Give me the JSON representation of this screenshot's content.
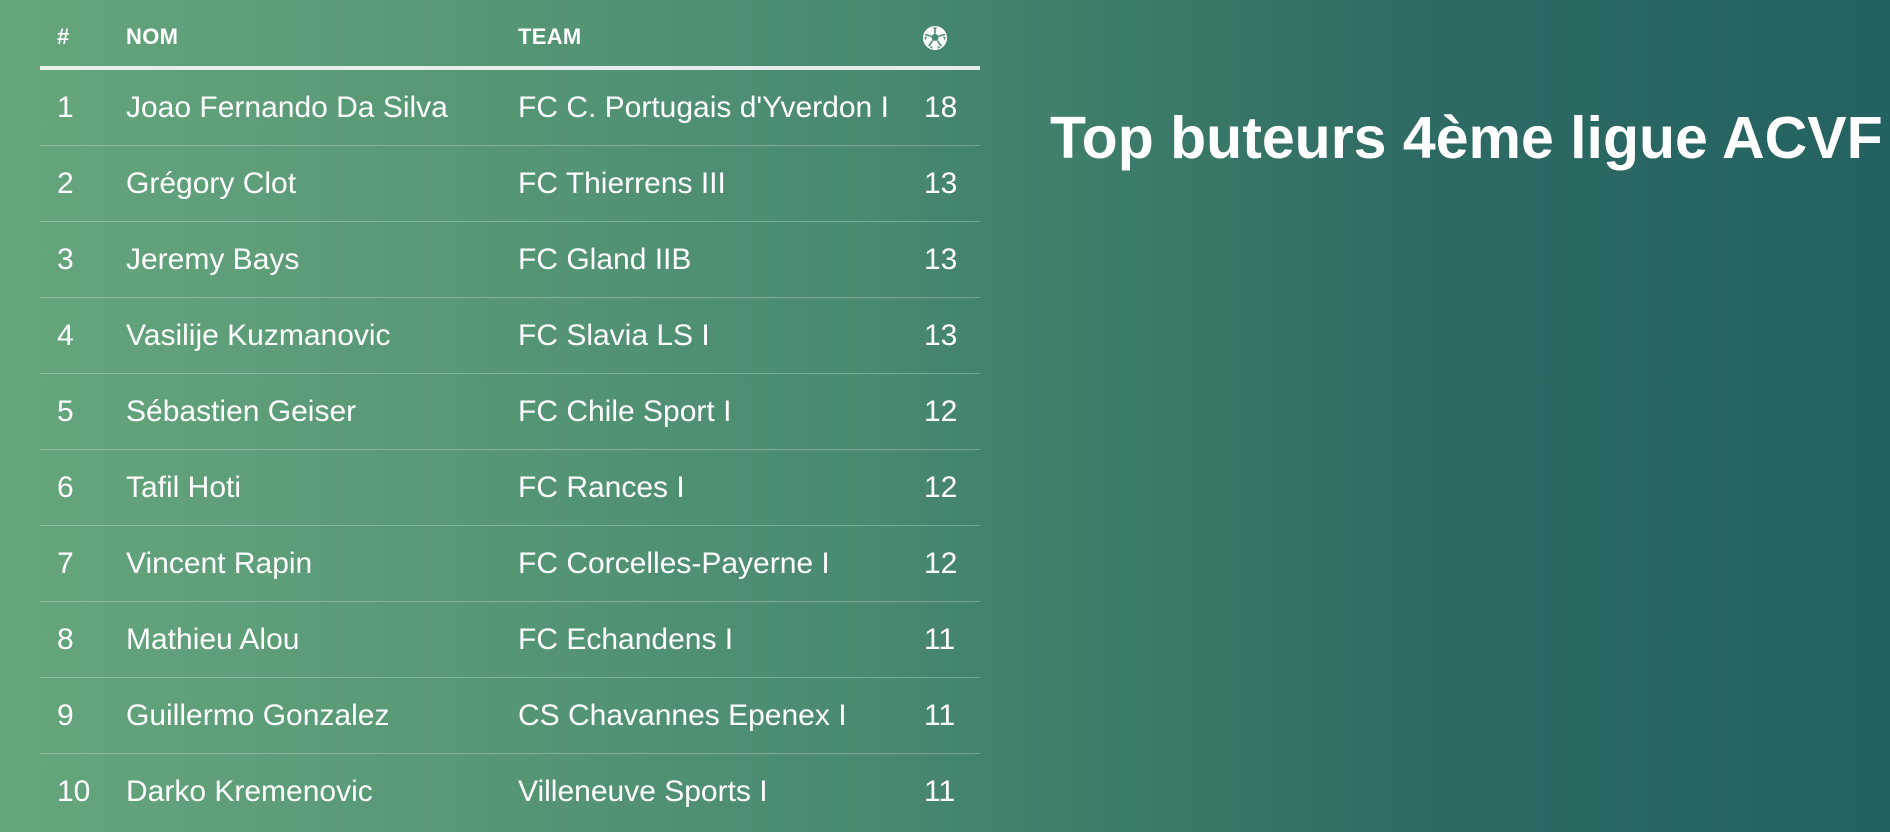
{
  "title": "Top buteurs 4ème ligue ACVF",
  "table": {
    "headers": {
      "rank": "#",
      "name": "NOM",
      "team": "TEAM",
      "goals_icon": "soccer-ball-icon"
    },
    "rows": [
      {
        "rank": "1",
        "name": "Joao Fernando Da Silva",
        "team": "FC C. Portugais d'Yverdon I",
        "goals": "18"
      },
      {
        "rank": "2",
        "name": "Grégory Clot",
        "team": "FC Thierrens III",
        "goals": "13"
      },
      {
        "rank": "3",
        "name": "Jeremy Bays",
        "team": "FC Gland IIB",
        "goals": "13"
      },
      {
        "rank": "4",
        "name": "Vasilije Kuzmanovic",
        "team": "FC Slavia LS I",
        "goals": "13"
      },
      {
        "rank": "5",
        "name": "Sébastien Geiser",
        "team": "FC Chile Sport I",
        "goals": "12"
      },
      {
        "rank": "6",
        "name": "Tafil Hoti",
        "team": "FC Rances I",
        "goals": "12"
      },
      {
        "rank": "7",
        "name": "Vincent Rapin",
        "team": "FC Corcelles-Payerne I",
        "goals": "12"
      },
      {
        "rank": "8",
        "name": "Mathieu Alou",
        "team": "FC Echandens I",
        "goals": "11"
      },
      {
        "rank": "9",
        "name": "Guillermo Gonzalez",
        "team": "CS Chavannes Epenex I",
        "goals": "11"
      },
      {
        "rank": "10",
        "name": "Darko Kremenovic",
        "team": "Villeneuve Sports I",
        "goals": "11"
      }
    ]
  },
  "colors": {
    "background_left": "#66a67c",
    "background_right": "#24625f",
    "text": "#ffffff"
  }
}
